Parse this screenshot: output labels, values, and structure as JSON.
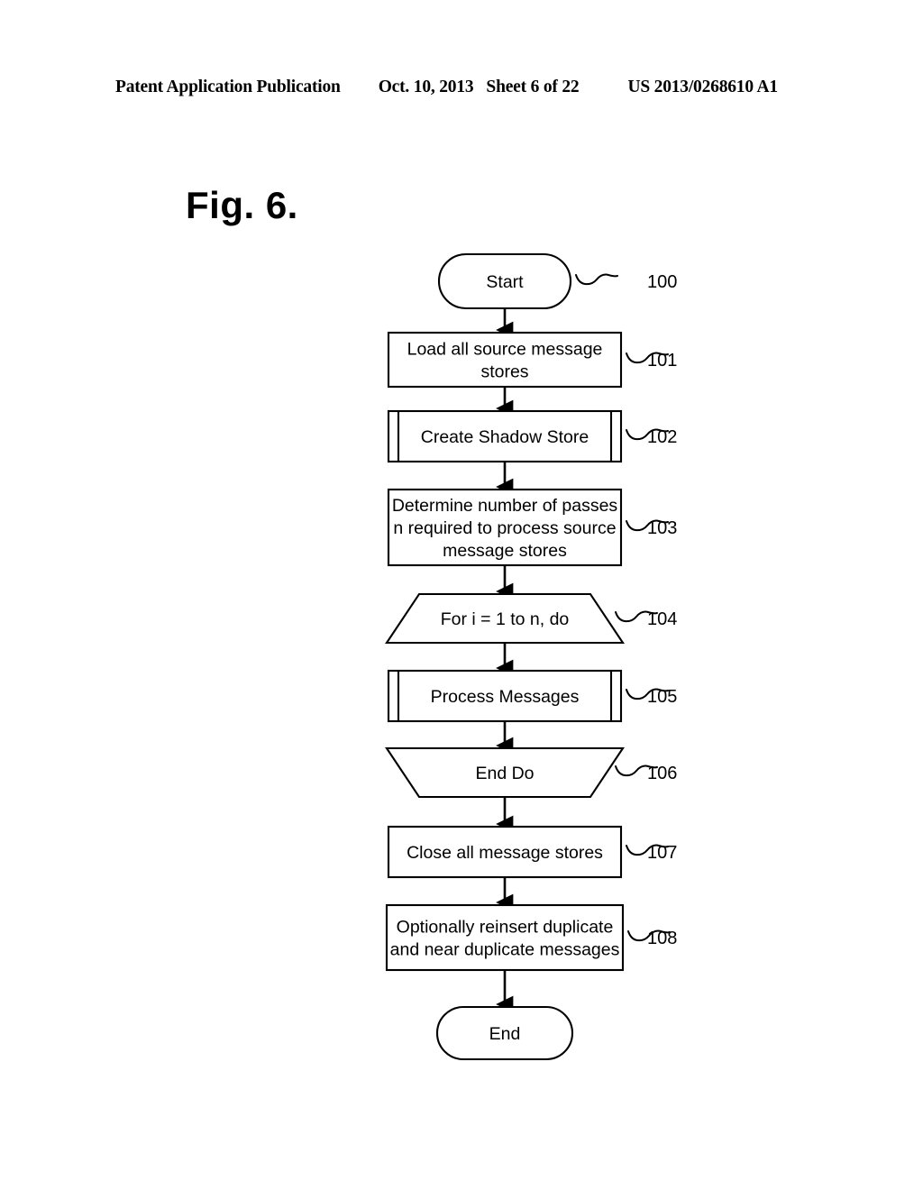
{
  "header": {
    "publication": "Patent Application Publication",
    "date": "Oct. 10, 2013",
    "sheet": "Sheet 6 of 22",
    "patent_number": "US 2013/0268610 A1"
  },
  "figure": {
    "title": "Fig. 6."
  },
  "flowchart": {
    "nodes": [
      {
        "id": "start",
        "shape": "terminator",
        "text": [
          "Start"
        ],
        "ref": "100"
      },
      {
        "id": "n101",
        "shape": "process",
        "text": [
          "Load all source message",
          "stores"
        ],
        "ref": "101"
      },
      {
        "id": "n102",
        "shape": "predefined-process",
        "text": [
          "Create Shadow Store"
        ],
        "ref": "102"
      },
      {
        "id": "n103",
        "shape": "process",
        "text": [
          "Determine number of passes",
          "n required to process source",
          "message stores"
        ],
        "ref": "103"
      },
      {
        "id": "n104",
        "shape": "loop-start",
        "text": [
          "For i = 1 to n, do"
        ],
        "ref": "104"
      },
      {
        "id": "n105",
        "shape": "predefined-process",
        "text": [
          "Process Messages"
        ],
        "ref": "105"
      },
      {
        "id": "n106",
        "shape": "loop-end",
        "text": [
          "End  Do"
        ],
        "ref": "106"
      },
      {
        "id": "n107",
        "shape": "process",
        "text": [
          "Close all message stores"
        ],
        "ref": "107"
      },
      {
        "id": "n108",
        "shape": "process",
        "text": [
          "Optionally reinsert duplicate",
          "and near duplicate messages"
        ],
        "ref": "108"
      },
      {
        "id": "end",
        "shape": "terminator",
        "text": [
          "End"
        ],
        "ref": ""
      }
    ],
    "edges": [
      {
        "from": "start",
        "to": "n101"
      },
      {
        "from": "n101",
        "to": "n102"
      },
      {
        "from": "n102",
        "to": "n103"
      },
      {
        "from": "n103",
        "to": "n104"
      },
      {
        "from": "n104",
        "to": "n105"
      },
      {
        "from": "n105",
        "to": "n106"
      },
      {
        "from": "n106",
        "to": "n107"
      },
      {
        "from": "n107",
        "to": "n108"
      },
      {
        "from": "n108",
        "to": "end"
      }
    ],
    "colors": {
      "stroke": "#000000",
      "fill": "#ffffff",
      "text": "#000000"
    }
  }
}
